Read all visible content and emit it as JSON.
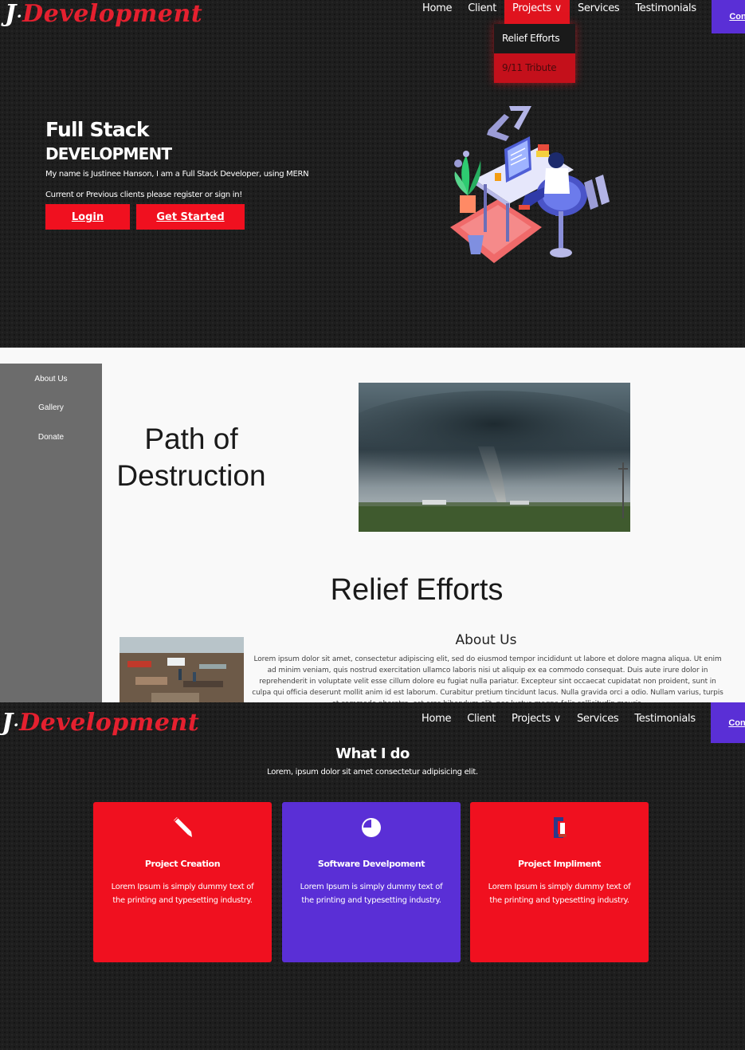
{
  "hero": {
    "logo": {
      "initial": "J",
      "dot": "·",
      "name": "Development"
    },
    "nav": {
      "items": [
        "Home",
        "Client",
        "Projects ∨",
        "Services",
        "Testimonials"
      ],
      "contact": "Contact"
    },
    "dropdown": [
      "Relief Efforts",
      "9/11 Tribute"
    ],
    "title": "Full Stack",
    "subtitle": "DEVELOPMENT",
    "description": "My name is Justinee Hanson, I am a Full Stack Developer, using MERN",
    "prompt": "Current or Previous clients please register or sign in!",
    "buttons": {
      "login": "Login",
      "start": "Get Started"
    }
  },
  "relief": {
    "sidebar": [
      "About Us",
      "Gallery",
      "Donate"
    ],
    "path_title_line1": "Path of",
    "path_title_line2": "Destruction",
    "heading": "Relief Efforts",
    "about_title": "About Us",
    "about_body": "Lorem ipsum dolor sit amet, consectetur adipiscing elit, sed do eiusmod tempor incididunt ut labore et dolore magna aliqua. Ut enim ad minim veniam, quis nostrud exercitation ullamco laboris nisi ut aliquip ex ea commodo consequat. Duis aute irure dolor in reprehenderit in voluptate velit esse cillum dolore eu fugiat nulla pariatur. Excepteur sint occaecat cupidatat non proident, sunt in culpa qui officia deserunt mollit anim id est laborum. Curabitur pretium tincidunt lacus. Nulla gravida orci a odio. Nullam varius, turpis et commodo pharetra, est eros bibendum elit, nec luctus magna felis sollicitudin mauris."
  },
  "services": {
    "logo": {
      "initial": "J",
      "dot": "·",
      "name": "Development"
    },
    "nav": {
      "items": [
        "Home",
        "Client",
        "Projects ∨",
        "Services",
        "Testimonials"
      ],
      "contact": "Contact"
    },
    "title": "What I do",
    "subtitle": "Lorem, ipsum dolor sit amet consectetur adipisicing elit.",
    "cards": [
      {
        "title": "Project Creation",
        "desc": "Lorem Ipsum is simply dummy text of the printing and typesetting industry.",
        "icon": "pencil-icon"
      },
      {
        "title": "Software Develpoment",
        "desc": "Lorem Ipsum is simply dummy text of the printing and typesetting industry.",
        "icon": "pie-chart-icon"
      },
      {
        "title": "Project Impliment",
        "desc": "Lorem Ipsum is simply dummy text of the printing and typesetting industry.",
        "icon": "clamp-icon"
      }
    ]
  },
  "colors": {
    "accent_red": "#f0101f",
    "accent_purple": "#5a2fd6",
    "logo_red": "#e5202f"
  }
}
